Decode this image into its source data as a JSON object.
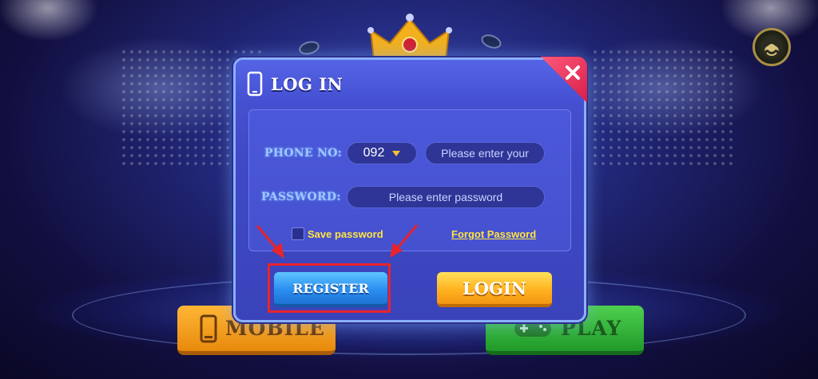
{
  "dialog": {
    "title": "LOG IN",
    "phone_label": "PHONE NO:",
    "country_code": "092",
    "phone_placeholder": "Please enter your",
    "password_label": "PASSWORD:",
    "password_placeholder": "Please enter password",
    "save_password_label": "Save password",
    "save_password_checked": false,
    "forgot_password_label": "Forgot Password",
    "register_label": "REGISTER",
    "login_label": "LOGIN"
  },
  "background": {
    "mobile_label": "MOBILE",
    "play_label": "PLAY"
  },
  "colors": {
    "accent_yellow": "#ffe441",
    "register_blue": "#2b8ef0",
    "login_orange": "#ffb321",
    "highlight_red": "#e8242c",
    "close_red": "#d81e4a"
  },
  "icons": [
    "avatar-icon",
    "crown-icon",
    "phone-icon",
    "close-icon",
    "caret-down-icon",
    "mobile-icon",
    "gamepad-icon",
    "arrow-icon"
  ]
}
